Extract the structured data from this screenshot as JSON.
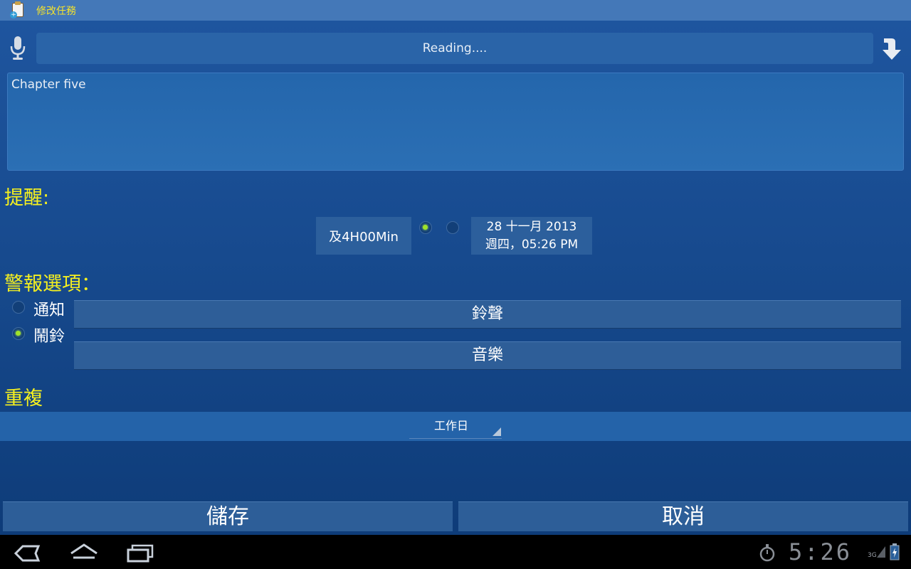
{
  "titlebar": {
    "title": "修改任務"
  },
  "voice_bar": {
    "text": "Reading...."
  },
  "task_text": "Chapter five",
  "reminder": {
    "heading": "提醒:",
    "interval_label": "及4H00Min",
    "interval_selected": true,
    "date_selected": false,
    "date_line1": "28 十一月 2013",
    "date_line2": "週四，05:26 PM"
  },
  "alert_options": {
    "heading": "警報選項：",
    "notify_label": "通知",
    "notify_selected": false,
    "alarm_label": "鬧鈴",
    "alarm_selected": true,
    "ringtone_button": "鈴聲",
    "music_button": "音樂"
  },
  "repeat": {
    "heading": "重複",
    "selected_value": "工作日"
  },
  "actions": {
    "save_label": "儲存",
    "cancel_label": "取消"
  },
  "status_bar": {
    "time": "5:26",
    "network": "3G"
  },
  "icons": {
    "app": "task-edit-icon",
    "mic": "microphone-icon",
    "download": "down-arrow-icon",
    "back": "back-icon",
    "home": "home-icon",
    "recent": "recent-apps-icon",
    "stopwatch": "stopwatch-icon",
    "signal": "signal-icon",
    "battery": "battery-icon"
  },
  "colors": {
    "heading_yellow": "#f5f01f",
    "radio_on": "#9ee32a",
    "titlebar": "#4478b8"
  }
}
